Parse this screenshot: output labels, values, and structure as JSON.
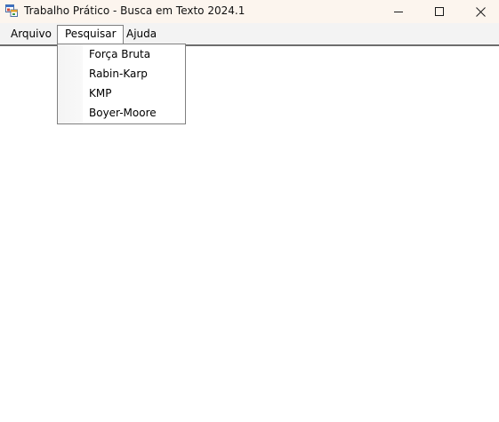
{
  "window": {
    "title": "Trabalho Prático - Busca em Texto 2024.1",
    "icon": "app-form-icon",
    "controls": [
      "minimize-icon",
      "maximize-icon",
      "close-icon"
    ]
  },
  "menubar": {
    "items": [
      {
        "label": "Arquivo"
      },
      {
        "label": "Pesquisar",
        "open": true
      },
      {
        "label": "Ajuda"
      }
    ]
  },
  "dropdown": {
    "items": [
      {
        "label": "Força Bruta"
      },
      {
        "label": "Rabin-Karp"
      },
      {
        "label": "KMP"
      },
      {
        "label": "Boyer-Moore"
      }
    ]
  }
}
